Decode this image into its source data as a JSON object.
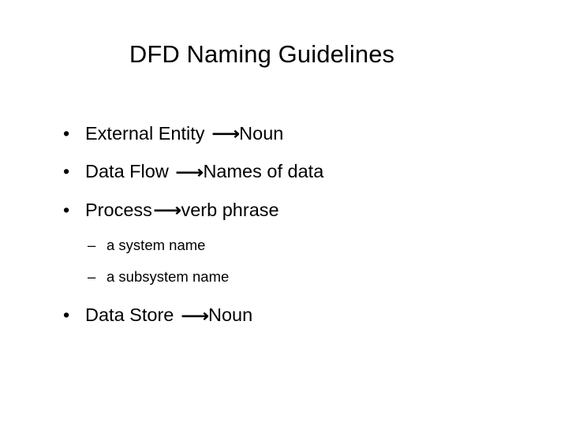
{
  "slide": {
    "title": "DFD Naming Guidelines",
    "background_color": "#ffffff",
    "text_color": "#000000",
    "bullet_marker": "•",
    "dash_marker": "–",
    "arrow_glyph": "→",
    "items": [
      {
        "level": 1,
        "marker": "•",
        "before_arrow": "External Entity",
        "after_arrow": "Noun",
        "full_text": "External Entity  → Noun",
        "wide_gap": true
      },
      {
        "level": 1,
        "marker": "•",
        "before_arrow": "Data Flow",
        "after_arrow": "Names of data",
        "full_text": "Data Flow  → Names of data",
        "wide_gap": true
      },
      {
        "level": 1,
        "marker": "•",
        "before_arrow": "Process",
        "after_arrow": "verb phrase",
        "full_text": "Process → verb phrase",
        "wide_gap": false
      },
      {
        "level": 2,
        "marker": "–",
        "before_arrow": "a system name",
        "after_arrow": "",
        "full_text": "a system name",
        "wide_gap": false
      },
      {
        "level": 2,
        "marker": "–",
        "before_arrow": "a subsystem name",
        "after_arrow": "",
        "full_text": "a subsystem name",
        "wide_gap": false
      },
      {
        "level": 1,
        "marker": "•",
        "before_arrow": "Data Store",
        "after_arrow": "Noun",
        "full_text": "Data Store  → Noun",
        "wide_gap": true
      }
    ]
  }
}
